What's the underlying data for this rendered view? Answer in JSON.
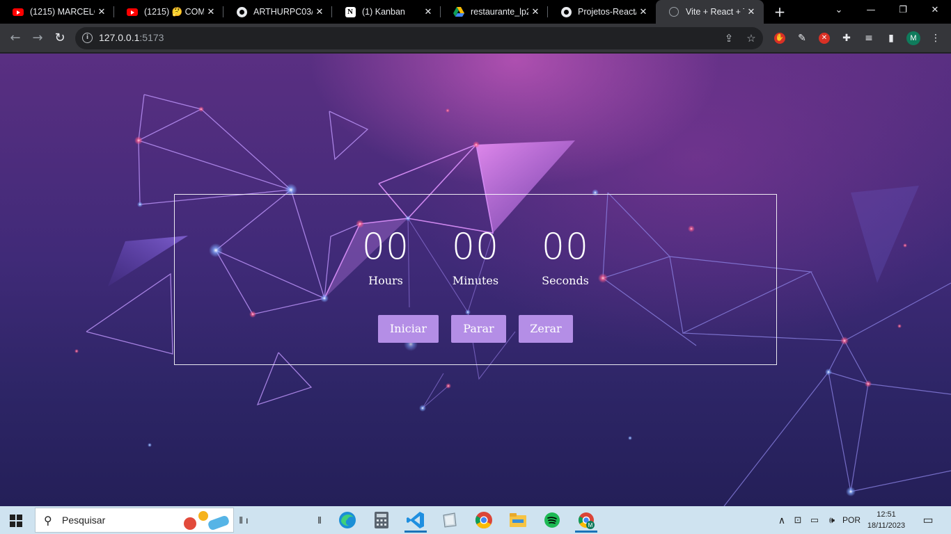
{
  "browser": {
    "tabs": [
      {
        "title": "(1215) MARCELO",
        "icon": "youtube-icon"
      },
      {
        "title": "(1215) 🤔 COMO",
        "icon": "youtube-icon"
      },
      {
        "title": "ARTHURPC03/Ge",
        "icon": "github-icon"
      },
      {
        "title": "(1) Kanban",
        "icon": "notion-icon"
      },
      {
        "title": "restaurante_lp2.a",
        "icon": "google-drive-icon"
      },
      {
        "title": "Projetos-React/t",
        "icon": "github-icon"
      },
      {
        "title": "Vite + React + T",
        "icon": "globe-icon",
        "active": true
      }
    ],
    "url_host": "127.0.0.1",
    "url_port": ":5173",
    "profile_initial": "M"
  },
  "timer": {
    "hours": "00",
    "hours_label": "Hours",
    "minutes": "00",
    "minutes_label": "Minutes",
    "seconds": "00",
    "seconds_label": "Seconds"
  },
  "buttons": {
    "start": "Iniciar",
    "stop": "Parar",
    "reset": "Zerar"
  },
  "taskbar": {
    "search_placeholder": "Pesquisar",
    "language": "POR",
    "time": "12:51",
    "date": "18/11/2023"
  },
  "colors": {
    "button_bg": "#b48ee6",
    "tab_active": "#35363a",
    "taskbar_bg": "#cfe3f0"
  }
}
